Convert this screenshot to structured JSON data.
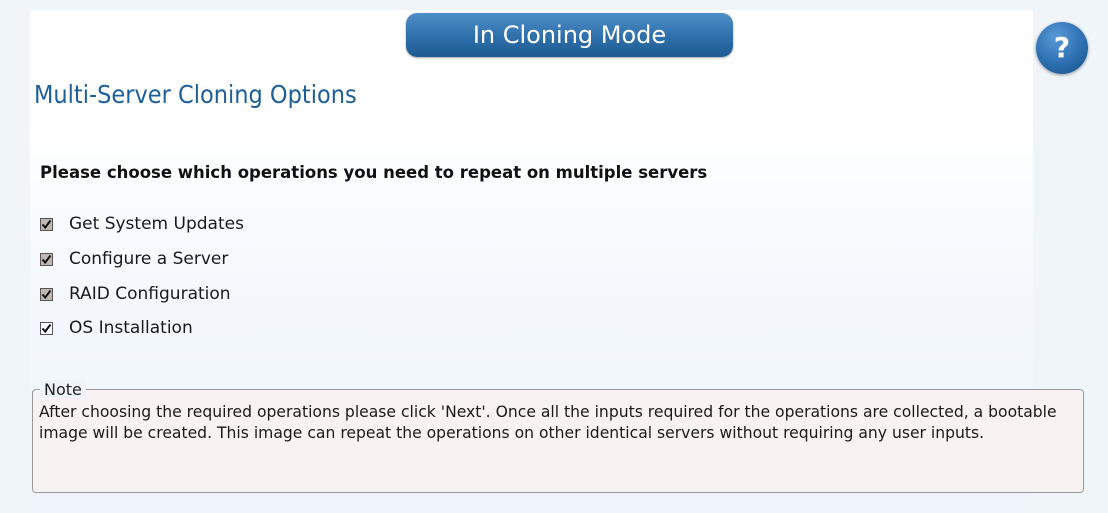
{
  "header": {
    "mode_banner": "In Cloning Mode",
    "help_label": "?"
  },
  "page": {
    "title": "Multi-Server Cloning Options",
    "prompt": "Please choose which operations you need to repeat on multiple servers"
  },
  "options": [
    {
      "label": "Get System Updates",
      "checked": true
    },
    {
      "label": "Configure a Server",
      "checked": true
    },
    {
      "label": "RAID Configuration",
      "checked": true
    },
    {
      "label": "OS Installation",
      "checked": true
    }
  ],
  "note": {
    "legend": "Note",
    "text": "After choosing the required operations please click 'Next'. Once all the inputs required for the operations are collected, a bootable image will be created. This image can repeat the operations on other identical servers without requiring any user inputs."
  },
  "colors": {
    "accent": "#1d5f9a",
    "banner": "#2e6faa",
    "background": "#f0f5fa"
  }
}
